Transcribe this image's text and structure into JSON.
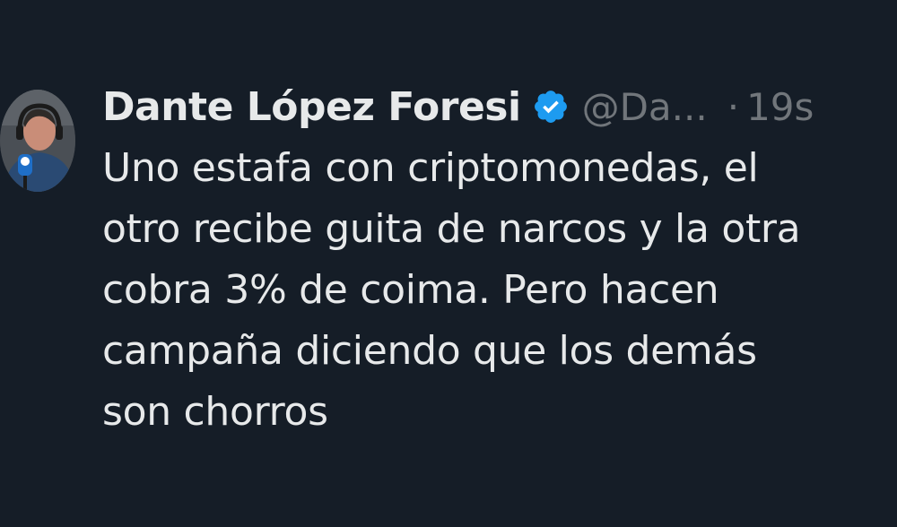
{
  "tweet": {
    "author": {
      "display_name": "Dante López Foresi",
      "handle": "@Da...",
      "verified": true
    },
    "separator": "·",
    "timestamp": "19s",
    "text": "Uno estafa con criptomonedas, el\notro recibe guita de narcos y la otra\ncobra 3% de coima. Pero hacen\ncampaña diciendo que los demás\nson chorros"
  },
  "colors": {
    "background": "#151d27",
    "primary_text": "#e7e9ea",
    "secondary_text": "#71767b",
    "verified_badge": "#1d9bf0"
  },
  "icons": {
    "avatar": "user-avatar-photo",
    "verified": "verified-badge-icon"
  }
}
